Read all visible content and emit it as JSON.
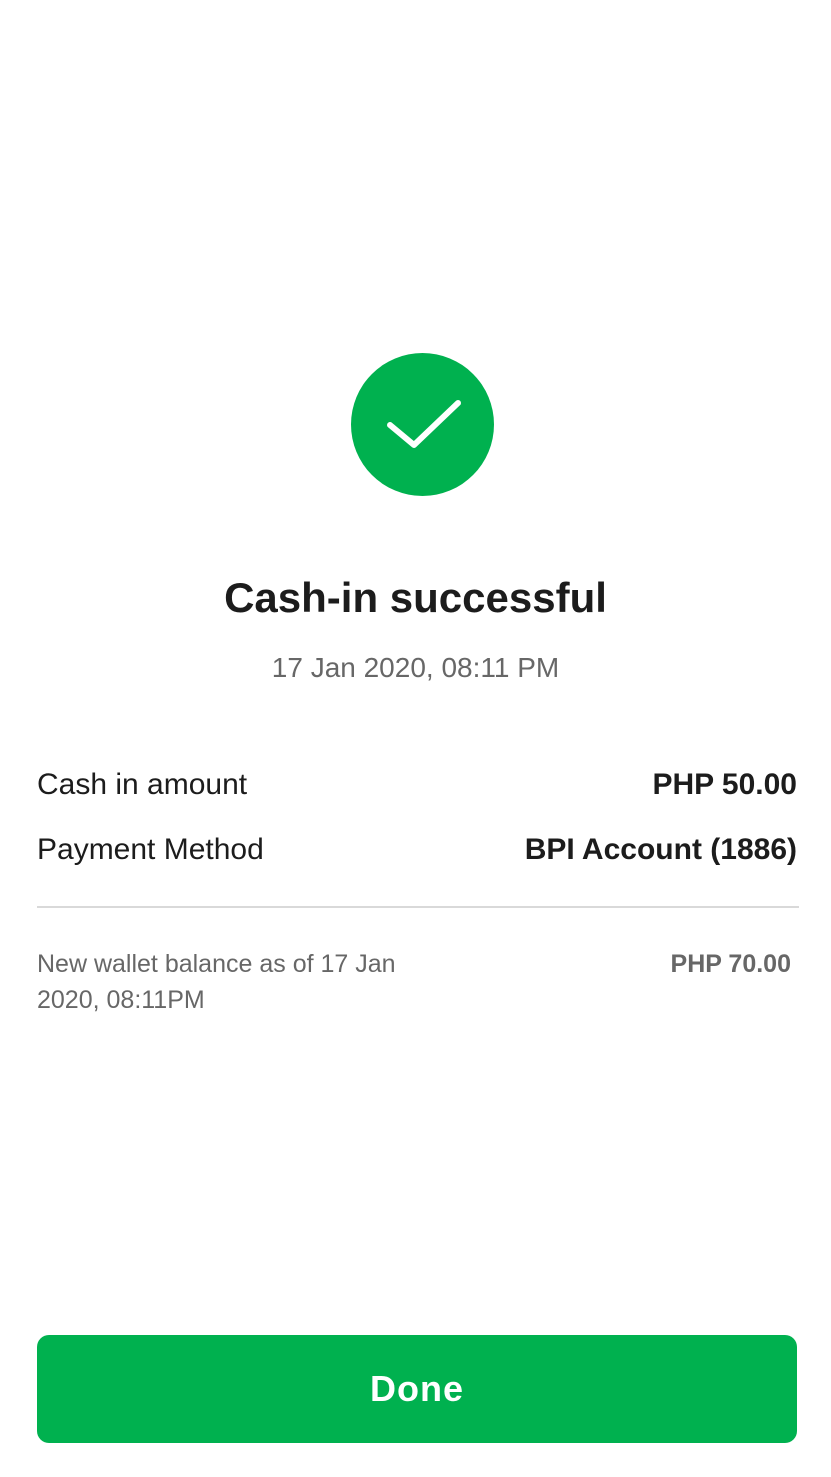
{
  "status": {
    "icon": "checkmark-icon",
    "title": "Cash-in successful",
    "timestamp": "17 Jan 2020, 08:11 PM"
  },
  "details": {
    "cash_in_amount": {
      "label": "Cash in amount",
      "value": "PHP 50.00"
    },
    "payment_method": {
      "label": "Payment Method",
      "value": "BPI Account (1886)"
    }
  },
  "balance": {
    "label": "New wallet balance as of 17 Jan 2020, 08:11PM",
    "value": "PHP 70.00"
  },
  "actions": {
    "done_label": "Done"
  },
  "colors": {
    "accent": "#00b14f",
    "text_primary": "#1c1c1c",
    "text_secondary": "#676767",
    "divider": "#d9d9d9"
  }
}
